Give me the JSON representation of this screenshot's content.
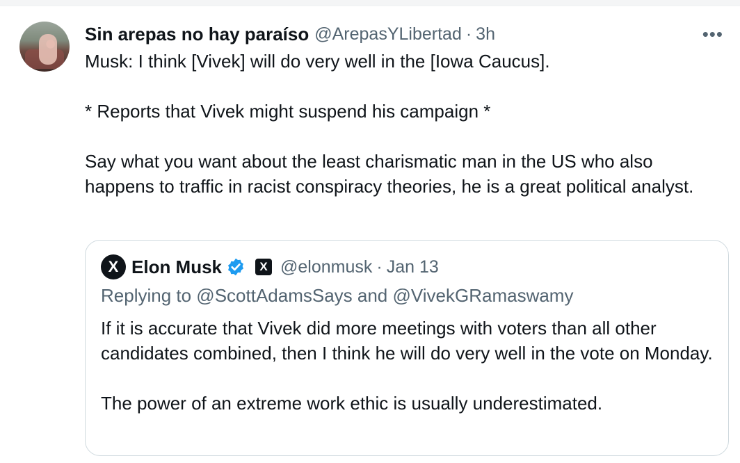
{
  "tweet": {
    "author_name": "Sin arepas no hay paraíso",
    "author_handle": "@ArepasYLibertad",
    "separator": "·",
    "time": "3h",
    "more_label": "•••",
    "text": "Musk: I think [Vivek] will do very well in the [Iowa Caucus].\n\n* Reports that Vivek might suspend his campaign *\n\nSay what you want about the least charismatic man in the US who also happens to traffic in racist conspiracy theories, he is a great political analyst."
  },
  "quote": {
    "avatar_glyph": "X",
    "author_name": "Elon Musk",
    "affiliation_glyph": "X",
    "author_handle": "@elonmusk",
    "separator": "·",
    "time": "Jan 13",
    "reply_line": "Replying to @ScottAdamsSays and @VivekGRamaswamy",
    "text": "If it is accurate that Vivek did more meetings with voters than all other candidates combined, then I think he will do very well in the vote on Monday.\n\nThe power of an extreme work ethic is usually underestimated."
  },
  "colors": {
    "text": "#0f1419",
    "secondary": "#536471",
    "verified": "#1d9bf0",
    "border": "#cfd9de"
  },
  "icons": {
    "verified": "verified-badge-icon",
    "more": "more-options-icon",
    "affiliation": "x-logo-icon"
  }
}
